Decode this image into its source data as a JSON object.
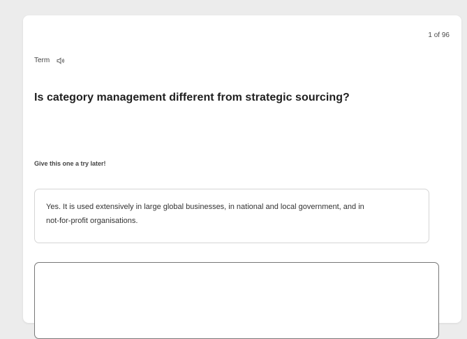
{
  "card": {
    "progress": "1 of 96",
    "term_label": "Term",
    "speaker_icon": "speaker-icon",
    "question": "Is category management different from strategic sourcing?",
    "hint": "Give this one a try later!",
    "option_text": "Yes. It is used extensively in large global businesses, in national and local government, and in not-for-profit organisations.",
    "answer_placeholder": ""
  },
  "colors": {
    "page_background": "#ececec",
    "card_background": "#ffffff",
    "border_light": "#d5d5d5",
    "border_dark": "#777777",
    "text_dark": "#1f1f1f"
  }
}
